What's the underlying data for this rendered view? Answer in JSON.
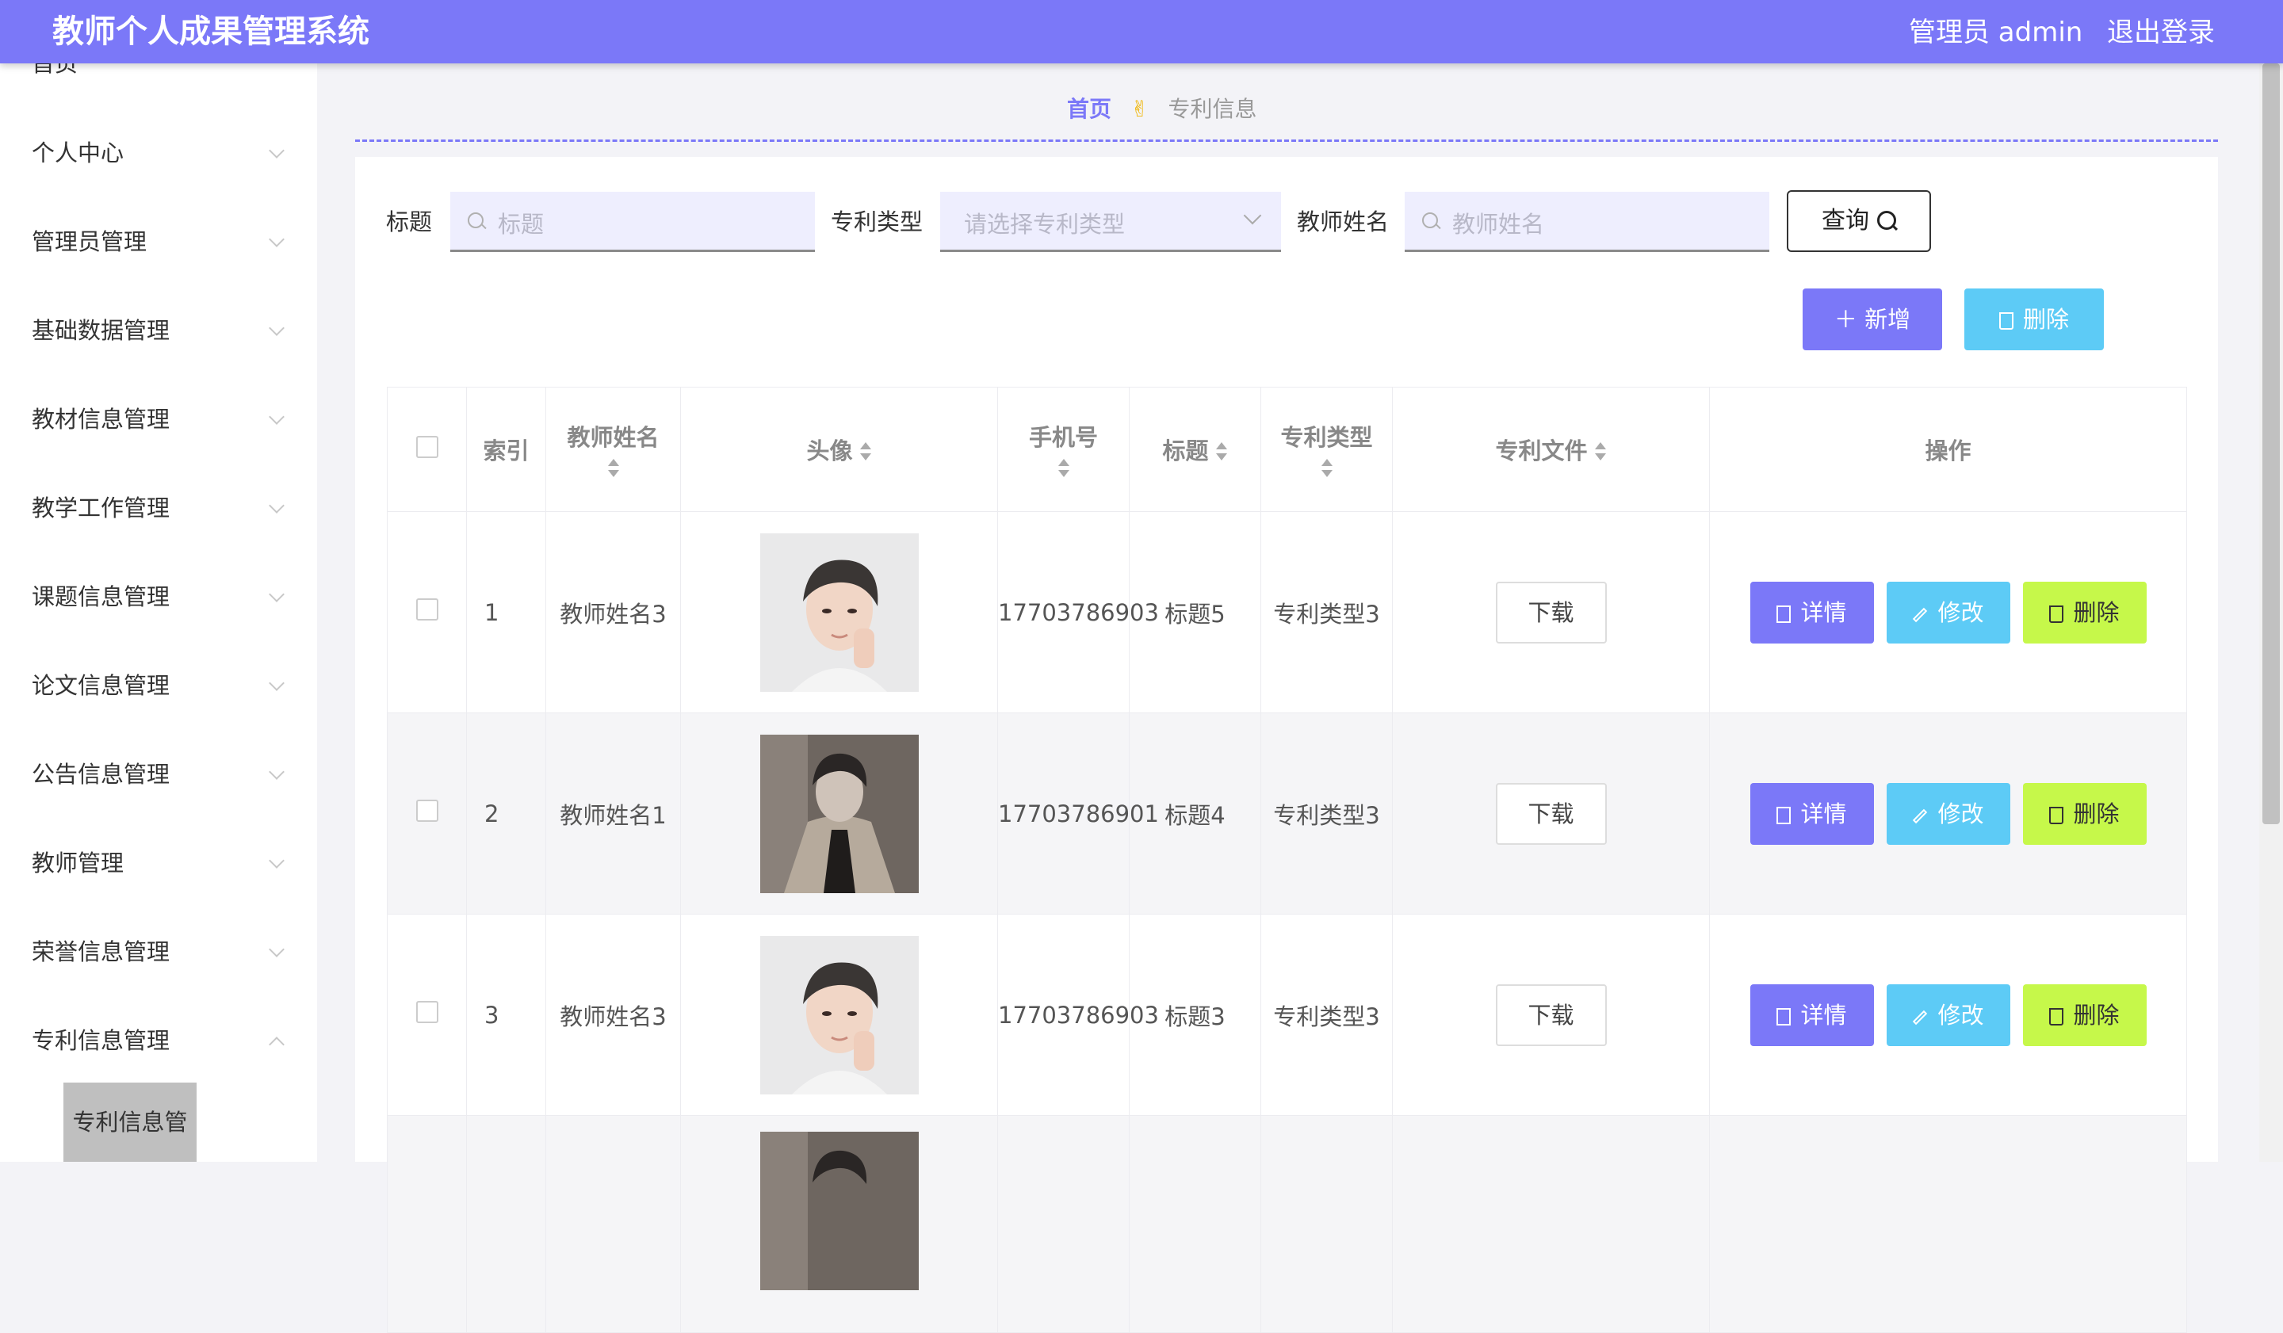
{
  "header": {
    "title": "教师个人成果管理系统",
    "admin": "管理员 admin",
    "logout": "退出登录"
  },
  "sidebar": {
    "items": [
      "首页",
      "个人中心",
      "管理员管理",
      "基础数据管理",
      "教材信息管理",
      "教学工作管理",
      "课题信息管理",
      "论文信息管理",
      "公告信息管理",
      "教师管理",
      "荣誉信息管理",
      "专利信息管理"
    ],
    "active_sub": "专利信息管理"
  },
  "breadcrumb": {
    "home": "首页",
    "separator": "✌",
    "current": "专利信息"
  },
  "search": {
    "title_label": "标题",
    "title_placeholder": "标题",
    "type_label": "专利类型",
    "type_placeholder": "请选择专利类型",
    "name_label": "教师姓名",
    "name_placeholder": "教师姓名",
    "query": "查询"
  },
  "toolbar": {
    "add": "新增",
    "delete": "删除"
  },
  "table": {
    "columns": [
      "索引",
      "教师姓名",
      "头像",
      "手机号",
      "标题",
      "专利类型",
      "专利文件",
      "操作"
    ],
    "rows": [
      {
        "index": "1",
        "name": "教师姓名3",
        "phone": "17703786903",
        "title": "标题5",
        "type": "专利类型3"
      },
      {
        "index": "2",
        "name": "教师姓名1",
        "phone": "17703786901",
        "title": "标题4",
        "type": "专利类型3"
      },
      {
        "index": "3",
        "name": "教师姓名3",
        "phone": "17703786903",
        "title": "标题3",
        "type": "专利类型3"
      }
    ],
    "download": "下载",
    "actions": {
      "detail": "详情",
      "edit": "修改",
      "delete": "删除"
    }
  },
  "colors": {
    "primary": "#7b78f8",
    "info": "#5dcbf6",
    "danger": "#c6f84a"
  }
}
